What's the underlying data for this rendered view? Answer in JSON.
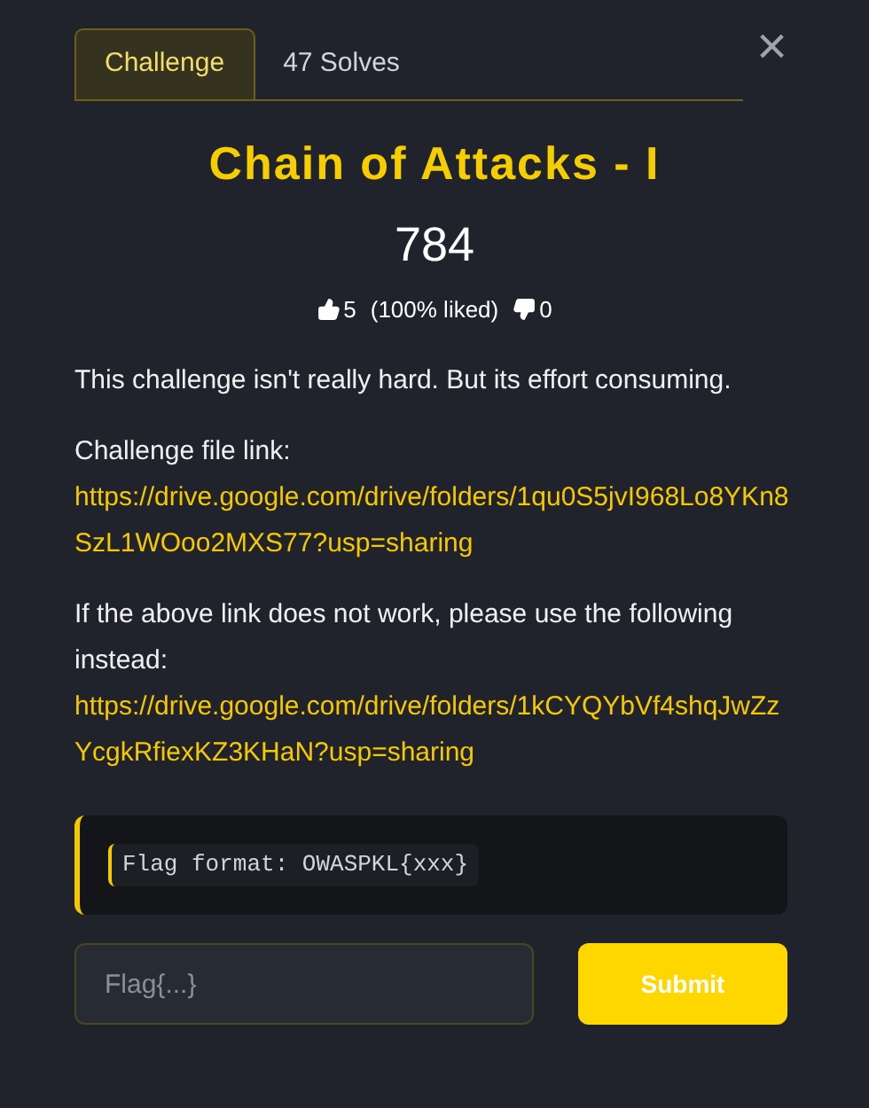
{
  "tabs": [
    {
      "label": "Challenge",
      "selected": true
    },
    {
      "label": "47 Solves",
      "selected": false
    }
  ],
  "close": {
    "label": "×"
  },
  "title": "Chain of Attacks - I",
  "points": "784",
  "votes": {
    "likes": "5",
    "liked_share": "(100% liked)",
    "dislikes": "0"
  },
  "description": [
    {
      "kind": "text",
      "text": "This challenge isn't really hard. But its effort consuming."
    },
    {
      "kind": "text",
      "text": "Challenge file link:"
    },
    {
      "kind": "link",
      "text": "https://drive.google.com/drive/folders/1qu0S5jvI968Lo8YKn8SzL1WOoo2MXS77?usp=sharing"
    },
    {
      "kind": "text",
      "text": "If the above link does not work, please use the following instead:"
    },
    {
      "kind": "link",
      "text": "https://drive.google.com/drive/folders/1kCYQYbVf4shqJwZzYcgkRfiexKZ3KHaN?usp=sharing"
    }
  ],
  "note": "Flag format: OWASPKL{xxx}",
  "flag_field": {
    "placeholder": "Flag{...}"
  },
  "submit": "Submit"
}
